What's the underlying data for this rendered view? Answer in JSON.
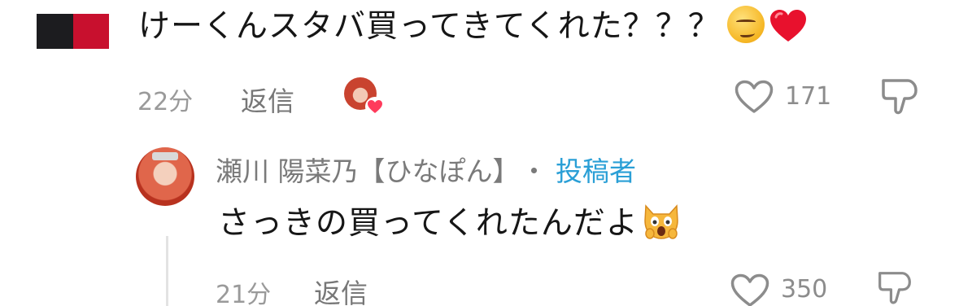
{
  "comment1": {
    "text": "けーくんスタバ買ってきてくれた？？？",
    "emoji": [
      "smirking-face",
      "red-heart"
    ],
    "time": "22分",
    "reply_label": "返信",
    "likes": "171"
  },
  "comment2": {
    "author": "瀬川 陽菜乃【ひなぽん】",
    "separator": "・",
    "author_badge": "投稿者",
    "text": "さっきの買ってくれたんだよ",
    "emoji": [
      "weary-cat-face"
    ],
    "time": "21分",
    "reply_label": "返信",
    "likes": "350"
  },
  "colors": {
    "poster_badge": "#2a9fd6",
    "heart": "#ff3b5c",
    "text": "#161616",
    "muted": "#9a9a9a"
  }
}
